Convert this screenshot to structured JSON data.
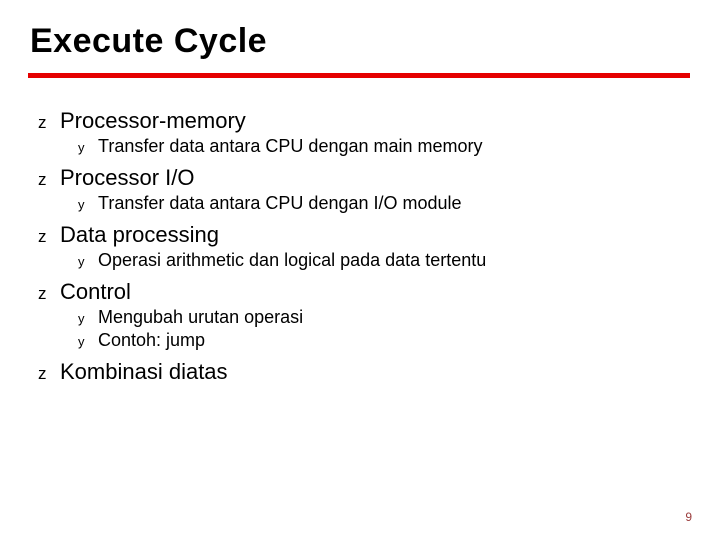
{
  "title": "Execute Cycle",
  "bullets": {
    "b1": "Processor-memory",
    "b1a": "Transfer data antara CPU dengan main memory",
    "b2": "Processor I/O",
    "b2a": "Transfer data antara CPU dengan I/O module",
    "b3": "Data processing",
    "b3a": "Operasi arithmetic dan logical pada data tertentu",
    "b4": "Control",
    "b4a": "Mengubah urutan operasi",
    "b4b": "Contoh: jump",
    "b5": "Kombinasi diatas"
  },
  "glyphs": {
    "lvl1": "z",
    "lvl2": "y"
  },
  "page_number": "9"
}
